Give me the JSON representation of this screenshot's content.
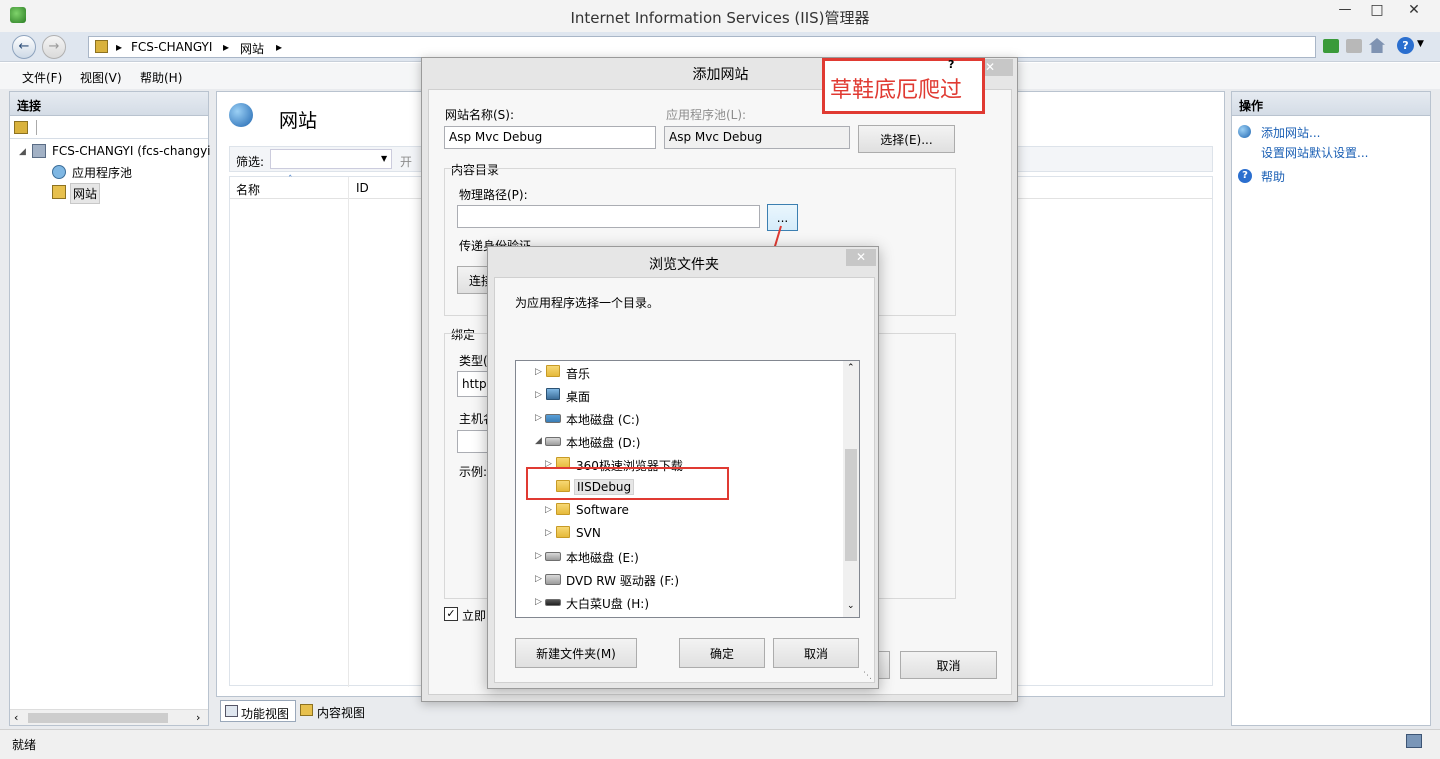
{
  "window": {
    "title": "Internet Information Services (IIS)管理器",
    "controls": [
      "—",
      "□",
      "✕"
    ]
  },
  "address": {
    "segments": [
      "FCS-CHANGYI",
      "网站"
    ]
  },
  "menu": {
    "items": [
      "文件(F)",
      "视图(V)",
      "帮助(H)"
    ]
  },
  "connections": {
    "header": "连接",
    "tree": [
      {
        "label": "FCS-CHANGYI (fcs-changyi"
      },
      {
        "label": "应用程序池"
      },
      {
        "label": "网站"
      }
    ]
  },
  "center": {
    "title": "网站",
    "filter_label": "筛选:",
    "filter_go": "开",
    "columns": [
      "名称",
      "ID"
    ],
    "tabs": [
      "功能视图",
      "内容视图"
    ]
  },
  "actions": {
    "header": "操作",
    "items": [
      "添加网站...",
      "设置网站默认设置...",
      "帮助"
    ]
  },
  "status": {
    "text": "就绪"
  },
  "add_site": {
    "title": "添加网站",
    "help": "?",
    "site_name_label": "网站名称(S):",
    "site_name_value": "Asp Mvc Debug",
    "app_pool_label": "应用程序池(L):",
    "app_pool_value": "Asp Mvc Debug",
    "select_button": "选择(E)...",
    "content_dir_label": "内容目录",
    "physical_path_label": "物理路径(P):",
    "physical_path_value": "",
    "browse_button": "...",
    "pass_auth_label": "传递身份验证",
    "connect_button": "连接",
    "binding_label": "绑定",
    "type_label": "类型(",
    "type_value": "http",
    "host_label": "主机名",
    "example_label": "示例:",
    "start_label": "立即",
    "cancel_button": "取消"
  },
  "annotation": {
    "text": "草鞋底厄爬过"
  },
  "browse": {
    "title": "浏览文件夹",
    "prompt": "为应用程序选择一个目录。",
    "tree": [
      {
        "label": "音乐",
        "icon": "music-folder-icon"
      },
      {
        "label": "桌面",
        "icon": "desktop-folder-icon"
      },
      {
        "label": "本地磁盘 (C:)",
        "icon": "system-drive-icon"
      },
      {
        "label": "本地磁盘 (D:)",
        "icon": "drive-icon"
      },
      {
        "label": "360极速浏览器下载",
        "icon": "folder-icon"
      },
      {
        "label": "IISDebug",
        "icon": "folder-icon"
      },
      {
        "label": "Software",
        "icon": "folder-icon"
      },
      {
        "label": "SVN",
        "icon": "folder-icon"
      },
      {
        "label": "本地磁盘 (E:)",
        "icon": "drive-icon"
      },
      {
        "label": "DVD RW 驱动器 (F:)",
        "icon": "dvd-drive-icon"
      },
      {
        "label": "大白菜U盘 (H:)",
        "icon": "usb-drive-icon"
      }
    ],
    "new_folder_button": "新建文件夹(M)",
    "ok_button": "确定",
    "cancel_button": "取消"
  },
  "colors": {
    "highlight": "#e03a32",
    "link": "#1a5fb4",
    "accent": "#2b6fcf"
  }
}
